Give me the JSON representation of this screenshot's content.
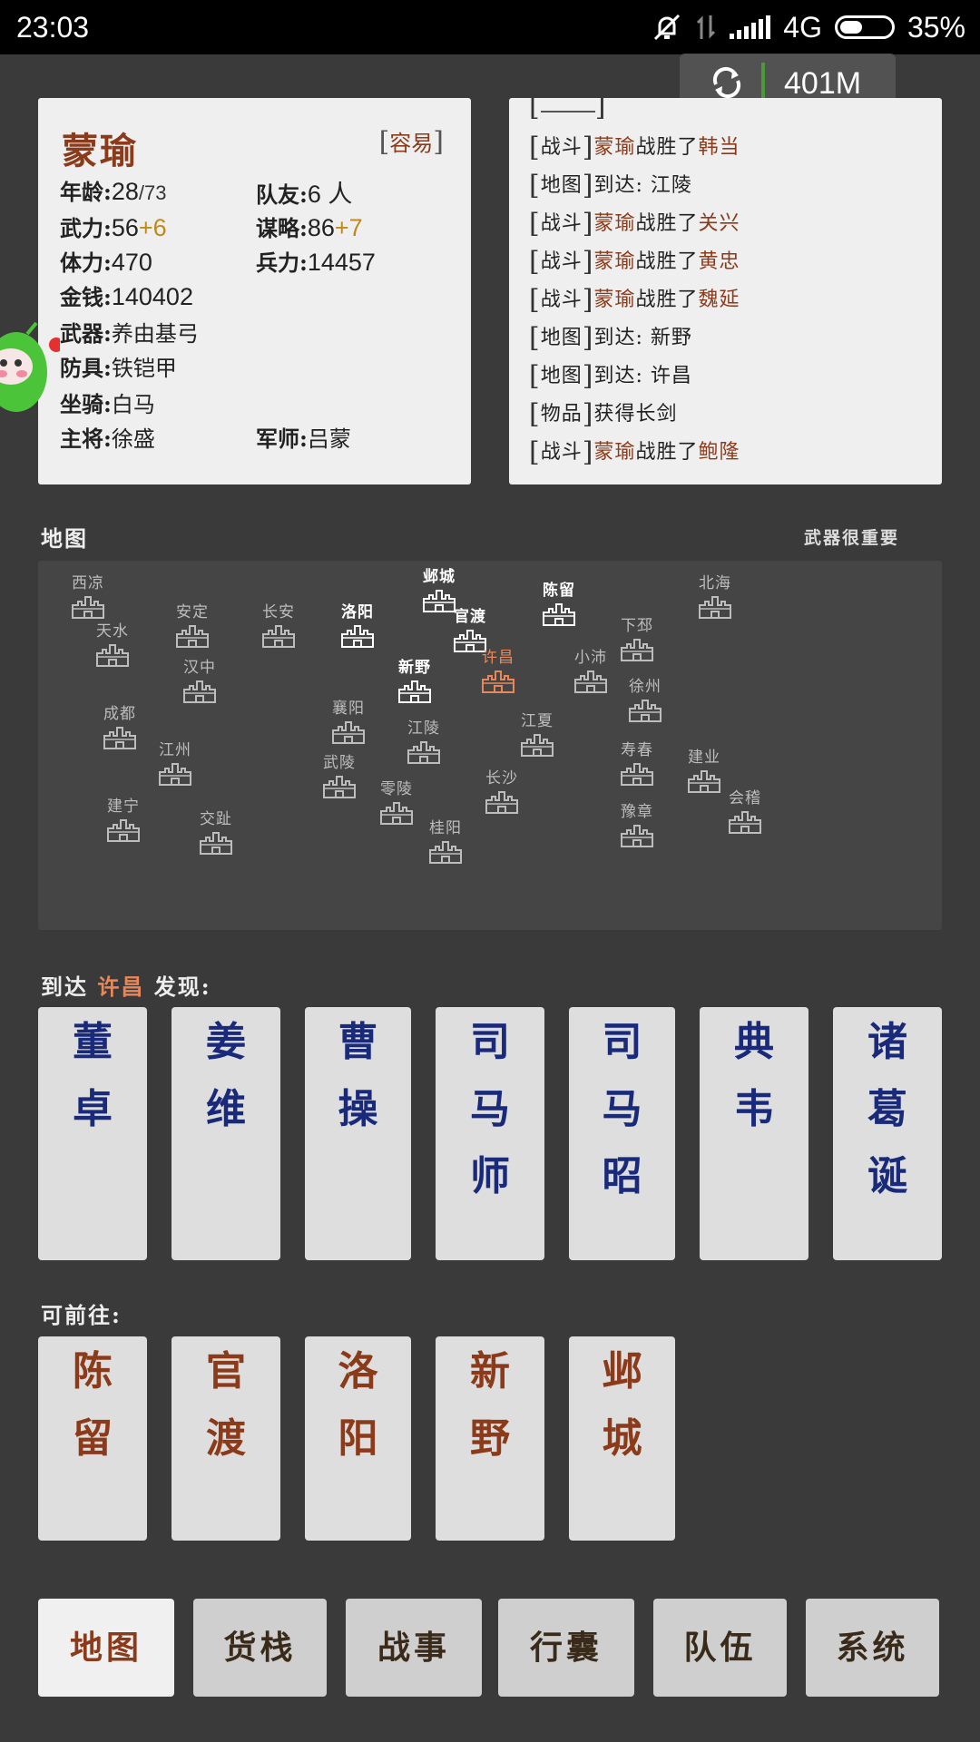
{
  "status_bar": {
    "time": "23:03",
    "network": "4G",
    "battery": "35%"
  },
  "memory_overlay": {
    "value": "401M"
  },
  "character": {
    "name": "蒙瑜",
    "difficulty": "容易",
    "age_label": "年龄:",
    "age": "28",
    "age_max": "/73",
    "teammates_label": "队友:",
    "teammates": "6 人",
    "force_label": "武力:",
    "force": "56",
    "force_bonus": "+6",
    "strategy_label": "谋略:",
    "strategy": "86",
    "strategy_bonus": "+7",
    "stamina_label": "体力:",
    "stamina": "470",
    "troops_label": "兵力:",
    "troops": "14457",
    "money_label": "金钱:",
    "money": "140402",
    "weapon_label": "武器:",
    "weapon": "养由基弓",
    "armor_label": "防具:",
    "armor": "铁铠甲",
    "mount_label": "坐骑:",
    "mount": "白马",
    "general_label": "主将:",
    "general": "徐盛",
    "advisor_label": "军师:",
    "advisor": "吕蒙"
  },
  "log": [
    {
      "cat": "战斗",
      "actor": "蒙瑜",
      "mid": "战胜了",
      "target": "韩当"
    },
    {
      "cat": "地图",
      "actor": "",
      "mid": "到达: 江陵",
      "target": ""
    },
    {
      "cat": "战斗",
      "actor": "蒙瑜",
      "mid": "战胜了",
      "target": "关兴"
    },
    {
      "cat": "战斗",
      "actor": "蒙瑜",
      "mid": "战胜了",
      "target": "黄忠"
    },
    {
      "cat": "战斗",
      "actor": "蒙瑜",
      "mid": "战胜了",
      "target": "魏延"
    },
    {
      "cat": "地图",
      "actor": "",
      "mid": "到达: 新野",
      "target": ""
    },
    {
      "cat": "地图",
      "actor": "",
      "mid": "到达: 许昌",
      "target": ""
    },
    {
      "cat": "物品",
      "actor": "",
      "mid": "获得长剑",
      "target": ""
    },
    {
      "cat": "战斗",
      "actor": "蒙瑜",
      "mid": "战胜了",
      "target": "鲍隆"
    }
  ],
  "map": {
    "title": "地图",
    "tip": "武器很重要",
    "cities": [
      {
        "name": "西凉",
        "state": "normal"
      },
      {
        "name": "天水",
        "state": "normal"
      },
      {
        "name": "安定",
        "state": "normal"
      },
      {
        "name": "长安",
        "state": "normal"
      },
      {
        "name": "洛阳",
        "state": "visited"
      },
      {
        "name": "邺城",
        "state": "visited"
      },
      {
        "name": "官渡",
        "state": "visited"
      },
      {
        "name": "陈留",
        "state": "visited"
      },
      {
        "name": "北海",
        "state": "normal"
      },
      {
        "name": "下邳",
        "state": "normal"
      },
      {
        "name": "许昌",
        "state": "current"
      },
      {
        "name": "小沛",
        "state": "normal"
      },
      {
        "name": "汉中",
        "state": "normal"
      },
      {
        "name": "新野",
        "state": "visited"
      },
      {
        "name": "徐州",
        "state": "normal"
      },
      {
        "name": "成都",
        "state": "normal"
      },
      {
        "name": "襄阳",
        "state": "normal"
      },
      {
        "name": "江陵",
        "state": "normal"
      },
      {
        "name": "江夏",
        "state": "normal"
      },
      {
        "name": "江州",
        "state": "normal"
      },
      {
        "name": "寿春",
        "state": "normal"
      },
      {
        "name": "建业",
        "state": "normal"
      },
      {
        "name": "武陵",
        "state": "normal"
      },
      {
        "name": "长沙",
        "state": "normal"
      },
      {
        "name": "零陵",
        "state": "normal"
      },
      {
        "name": "建宁",
        "state": "normal"
      },
      {
        "name": "会稽",
        "state": "normal"
      },
      {
        "name": "豫章",
        "state": "normal"
      },
      {
        "name": "交趾",
        "state": "normal"
      },
      {
        "name": "桂阳",
        "state": "normal"
      }
    ]
  },
  "discover": {
    "prefix": "到达",
    "city": "许昌",
    "suffix": "发现:",
    "people": [
      "董卓",
      "姜维",
      "曹操",
      "司马师",
      "司马昭",
      "典韦",
      "诸葛诞"
    ]
  },
  "travel": {
    "title": "可前往:",
    "places": [
      "陈留",
      "官渡",
      "洛阳",
      "新野",
      "邺城"
    ]
  },
  "nav": [
    "地图",
    "货栈",
    "战事",
    "行囊",
    "队伍",
    "系统"
  ],
  "colors": {
    "accent": "#8b3a1a",
    "person": "#1a2a7a",
    "highlight": "#e8885a",
    "bonus": "#c08a1a"
  }
}
